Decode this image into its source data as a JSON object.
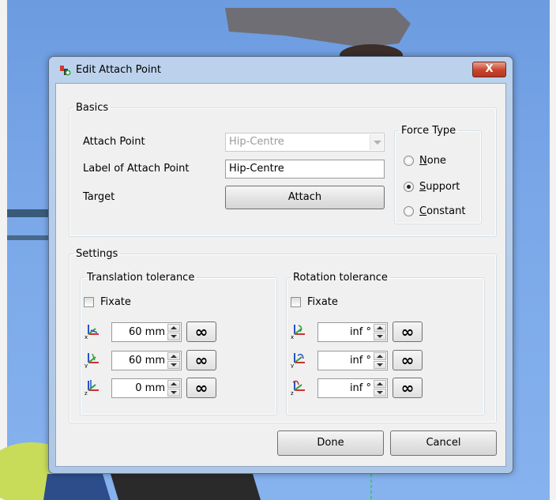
{
  "dialog": {
    "title": "Edit Attach Point",
    "close_label": "X",
    "basics": {
      "legend": "Basics",
      "attach_point_label": "Attach Point",
      "attach_point_value": "Hip-Centre",
      "label_of_attach_point_label": "Label of Attach Point",
      "label_value": "Hip-Centre",
      "target_label": "Target",
      "attach_button": "Attach"
    },
    "force_type": {
      "legend": "Force Type",
      "options": [
        {
          "hotkey": "N",
          "rest": "one",
          "checked": false
        },
        {
          "hotkey": "S",
          "rest": "upport",
          "checked": true
        },
        {
          "hotkey": "C",
          "rest": "onstant",
          "checked": false
        }
      ]
    },
    "settings": {
      "legend": "Settings",
      "translation": {
        "legend": "Translation tolerance",
        "fixate_label": "Fixate",
        "fixate_checked": false,
        "axes": [
          {
            "axis": "x",
            "value": "60 mm",
            "inf_label": "∞"
          },
          {
            "axis": "y",
            "value": "60 mm",
            "inf_label": "∞"
          },
          {
            "axis": "z",
            "value": "0 mm",
            "inf_label": "∞"
          }
        ]
      },
      "rotation": {
        "legend": "Rotation tolerance",
        "fixate_label": "Fixate",
        "fixate_checked": false,
        "axes": [
          {
            "axis": "x",
            "value": "inf °",
            "inf_label": "∞"
          },
          {
            "axis": "y",
            "value": "inf °",
            "inf_label": "∞"
          },
          {
            "axis": "z",
            "value": "inf °",
            "inf_label": "∞"
          }
        ]
      }
    },
    "done_button": "Done",
    "cancel_button": "Cancel"
  },
  "colors": {
    "viewport_sky": "#7aa7e8",
    "dialog_frame": "#aec7e6",
    "close_button": "#c9442d",
    "client_bg": "#f0f0f0"
  }
}
